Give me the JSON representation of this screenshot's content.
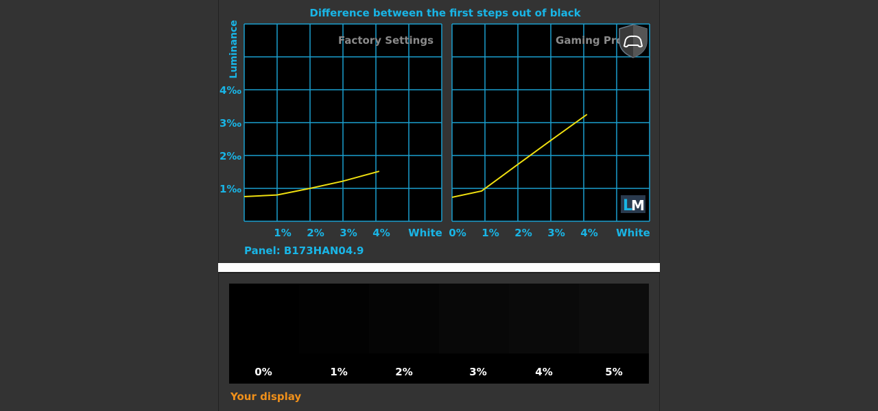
{
  "chart_data": [
    {
      "type": "line",
      "title": "Difference between the first steps out of black",
      "panel_label": "Factory Settings",
      "ylabel": "Luminance",
      "x_ticks": [
        "1%",
        "2%",
        "3%",
        "4%",
        "White"
      ],
      "y_ticks": [
        "1‰",
        "2‰",
        "3‰",
        "4‰"
      ],
      "ylim": [
        0,
        6
      ],
      "xlim": [
        0,
        6
      ],
      "grid": true,
      "x": [
        0,
        1,
        2,
        3,
        4.1
      ],
      "y": [
        0.75,
        0.8,
        1.0,
        1.22,
        1.52
      ],
      "line_color": "#f0e010"
    },
    {
      "type": "line",
      "panel_label": "Gaming Profile",
      "x_ticks": [
        "0%",
        "1%",
        "2%",
        "3%",
        "4%",
        "White"
      ],
      "ylim": [
        0,
        6
      ],
      "xlim": [
        0,
        6
      ],
      "grid": true,
      "x": [
        0,
        0.9,
        2,
        3,
        4.1
      ],
      "y": [
        0.73,
        0.92,
        1.73,
        2.46,
        3.25
      ],
      "line_color": "#f0e010"
    }
  ],
  "panel_name": "Panel: B173HAN04.9",
  "logo_text": {
    "l": "L",
    "m": "M"
  },
  "icon": "gamepad-shield-icon",
  "swatches": {
    "labels": [
      "0%",
      "1%",
      "2%",
      "3%",
      "4%",
      "5%"
    ],
    "colors": [
      "#000000",
      "#020202",
      "#050505",
      "#080808",
      "#0a0a0a",
      "#0d0d0d"
    ]
  },
  "your_display": "Your display",
  "colors": {
    "accent": "#19b5e6",
    "grid": "#1a9fd0",
    "orange": "#f0901a"
  }
}
